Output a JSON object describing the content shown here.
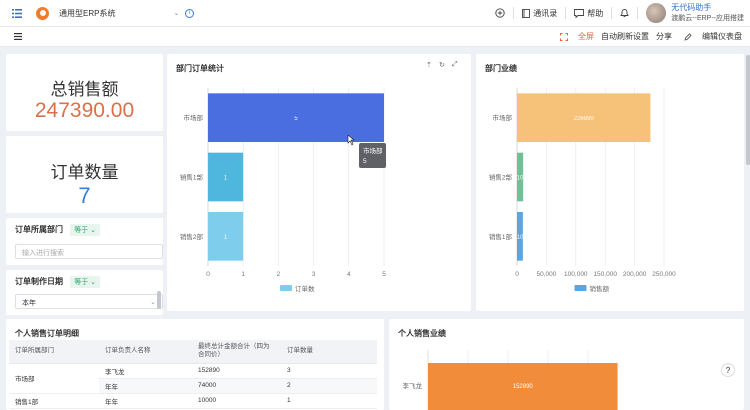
{
  "header": {
    "system_name": "通用型ERP系统",
    "chevron": "⌄",
    "info": "i",
    "address_book": "通讯录",
    "help": "帮助",
    "user_name": "无代码助手",
    "user_org": "渡鹏云--ERP--应用搭建"
  },
  "toolbar": {
    "fullscreen": "全屏",
    "auto_refresh": "自动刷新设置",
    "share": "分享",
    "edit": "编辑仪表盘"
  },
  "kpis": {
    "sales_title": "总销售额",
    "sales_value": "247390.00",
    "sales_color": "#d9714a",
    "orders_title": "订单数量",
    "orders_value": "7",
    "orders_color": "#3a7fd0"
  },
  "filters": {
    "dept_label": "订单所属部门",
    "dept_op": "等于",
    "dept_placeholder": "输入进行搜索",
    "date_label": "订单制作日期",
    "date_op": "等于",
    "date_value": "本年"
  },
  "chart_dept_orders": {
    "title": "部门订单统计",
    "tooltip_name": "市场部",
    "tooltip_value": "5"
  },
  "chart_dept_perf": {
    "title": "部门业绩"
  },
  "table": {
    "title": "个人销售订单明细",
    "headers": [
      "订单所属部门",
      "订单负责人名称",
      "最终总计金额合计（四为合同价）",
      "订单数量"
    ],
    "dept_1": "市场部",
    "dept_2": "销售1部",
    "rows": [
      [
        "",
        "李飞龙",
        "152890",
        "3"
      ],
      [
        "",
        "年年",
        "74000",
        "2"
      ],
      [
        "",
        "年年",
        "10000",
        "1"
      ]
    ]
  },
  "chart_personal": {
    "title": "个人销售业绩",
    "name": "李飞龙",
    "value_label": "152890"
  },
  "help_icon": "?",
  "chart_data": [
    {
      "type": "bar",
      "orientation": "horizontal",
      "title": "部门订单统计",
      "categories": [
        "市场部",
        "销售1部",
        "销售2部"
      ],
      "series": [
        {
          "name": "订单数",
          "values": [
            5,
            1,
            1
          ]
        }
      ],
      "data_labels": [
        "5",
        "1",
        "1"
      ],
      "xlim": [
        0,
        5
      ],
      "xticks": [
        "0",
        "1",
        "2",
        "3",
        "4",
        "5"
      ],
      "colors": [
        "#4a6ee0",
        "#4fb6de",
        "#7ecdec"
      ],
      "legend": "bottom",
      "grid": true
    },
    {
      "type": "bar",
      "orientation": "horizontal",
      "title": "部门业绩",
      "categories": [
        "市场部",
        "销售2部",
        "销售1部"
      ],
      "series": [
        {
          "name": "销售额",
          "values": [
            226890,
            10500,
            10000
          ]
        }
      ],
      "data_labels": [
        "226890",
        "10500",
        "10000"
      ],
      "xlim": [
        0,
        250000
      ],
      "xticks": [
        "0",
        "50,000",
        "100,000",
        "150,000",
        "200,000",
        "250,000"
      ],
      "colors": [
        "#f6c27a",
        "#6fc197",
        "#5aa6e3"
      ],
      "legend": "bottom",
      "grid": true
    },
    {
      "type": "bar",
      "orientation": "horizontal",
      "title": "个人销售业绩",
      "categories": [
        "李飞龙"
      ],
      "series": [
        {
          "name": "",
          "values": [
            152890
          ]
        }
      ],
      "data_labels": [
        "152890"
      ],
      "colors": [
        "#f08c3a"
      ]
    }
  ]
}
